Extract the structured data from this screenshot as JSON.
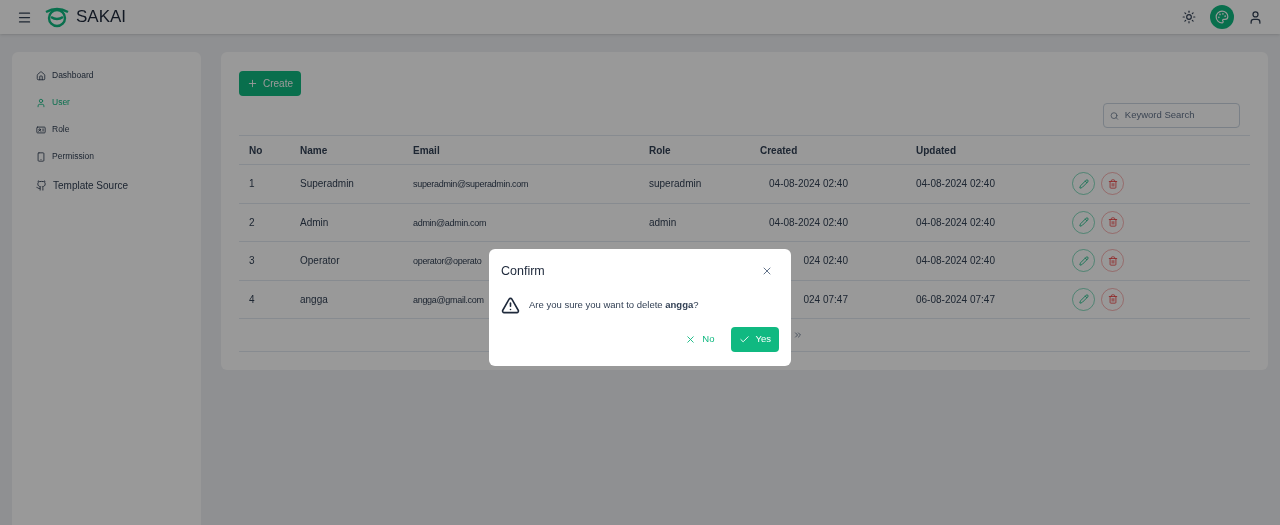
{
  "topbar": {
    "brand": "SAKAI"
  },
  "sidebar": {
    "items": [
      {
        "label": "Dashboard",
        "kind": "menu",
        "selected": false
      },
      {
        "label": "User",
        "kind": "menu",
        "selected": true
      },
      {
        "label": "Role",
        "kind": "menu",
        "selected": false
      },
      {
        "label": "Permission",
        "kind": "menu",
        "selected": false
      },
      {
        "label": "Template Source",
        "kind": "external",
        "selected": false
      }
    ]
  },
  "create_button": "Create",
  "search": {
    "placeholder": "Keyword Search"
  },
  "table": {
    "columns": [
      "No",
      "Name",
      "Email",
      "Role",
      "Created",
      "Updated"
    ],
    "rows": [
      {
        "cells": [
          "1",
          "Superadmin",
          "superadmin@superadmin.com",
          "superadmin",
          "04-08-2024 02:40",
          "04-08-2024 02:40"
        ]
      },
      {
        "cells": [
          "2",
          "Admin",
          "admin@admin.com",
          "admin",
          "04-08-2024 02:40",
          "04-08-2024 02:40"
        ]
      },
      {
        "cells": [
          "3",
          "Operator",
          "operator@operato",
          "",
          "024 02:40",
          "04-08-2024 02:40"
        ]
      },
      {
        "cells": [
          "4",
          "angga",
          "angga@gmail.com",
          "",
          "024 07:47",
          "06-08-2024 07:47"
        ]
      }
    ]
  },
  "dialog": {
    "title": "Confirm",
    "message": "Are you sure you want to delete **angga**?",
    "buttons": [
      {
        "label": "No",
        "kind": "text"
      },
      {
        "label": "Yes",
        "kind": "primary"
      }
    ]
  }
}
